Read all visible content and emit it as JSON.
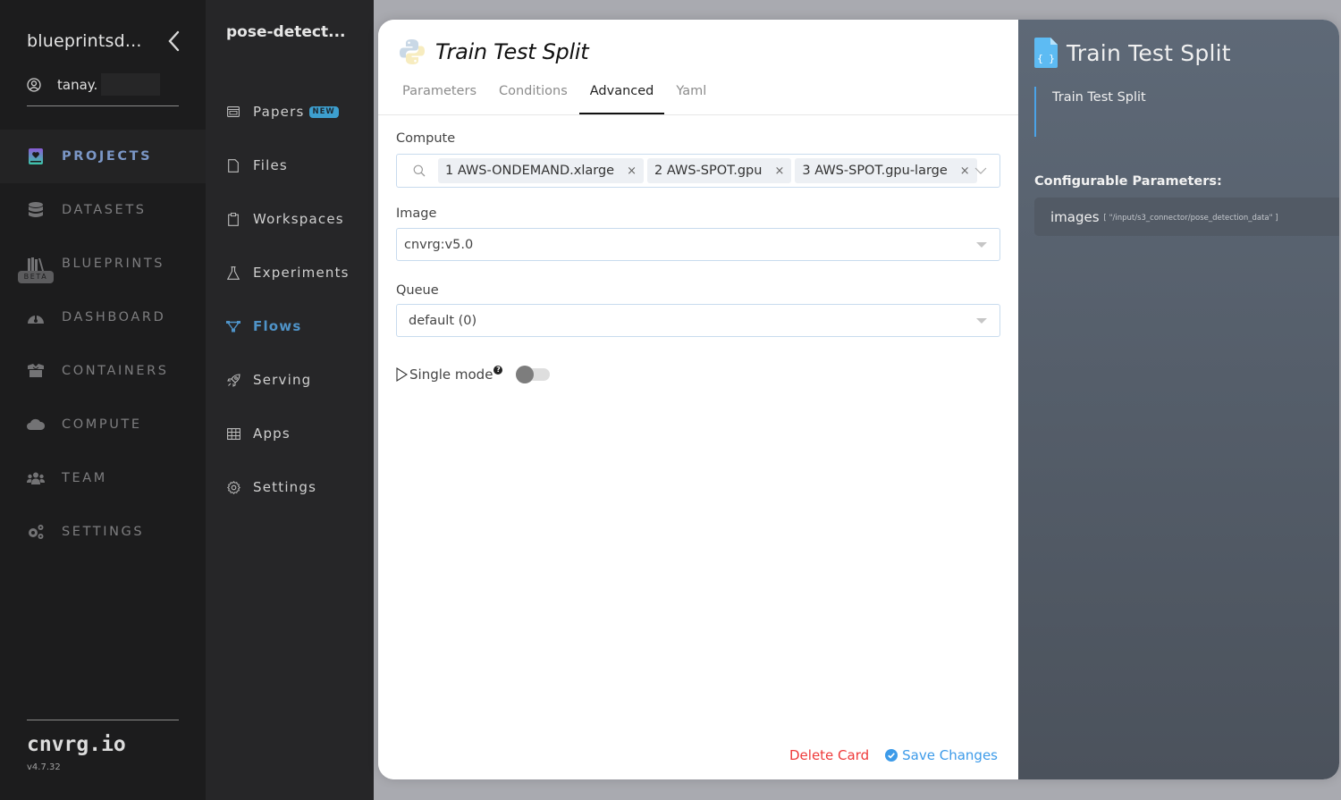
{
  "sidebar": {
    "org_name": "blueprintsd...",
    "user_name": "tanay.",
    "nav": [
      {
        "label": "PROJECTS",
        "icon": "projects-book-icon",
        "active": true
      },
      {
        "label": "DATASETS",
        "icon": "database-icon",
        "active": false
      },
      {
        "label": "BLUEPRINTS",
        "icon": "books-icon",
        "active": false,
        "badge": "BETA"
      },
      {
        "label": "DASHBOARD",
        "icon": "gauge-icon",
        "active": false
      },
      {
        "label": "CONTAINERS",
        "icon": "box-icon",
        "active": false
      },
      {
        "label": "COMPUTE",
        "icon": "cloud-icon",
        "active": false
      },
      {
        "label": "TEAM",
        "icon": "users-icon",
        "active": false
      },
      {
        "label": "SETTINGS",
        "icon": "gears-icon",
        "active": false
      }
    ],
    "brand": "cnvrg.io",
    "version": "v4.7.32"
  },
  "project_sidebar": {
    "title": "pose-detect...",
    "items": [
      {
        "label": "Papers",
        "icon": "papers-icon",
        "badge": "NEW"
      },
      {
        "label": "Files",
        "icon": "file-icon"
      },
      {
        "label": "Workspaces",
        "icon": "clipboard-icon"
      },
      {
        "label": "Experiments",
        "icon": "flask-icon"
      },
      {
        "label": "Flows",
        "icon": "flows-icon",
        "active": true
      },
      {
        "label": "Serving",
        "icon": "rocket-icon"
      },
      {
        "label": "Apps",
        "icon": "grid-icon"
      },
      {
        "label": "Settings",
        "icon": "gear-icon"
      }
    ]
  },
  "card": {
    "title": "Train Test Split",
    "tabs": [
      {
        "label": "Parameters",
        "active": false
      },
      {
        "label": "Conditions",
        "active": false
      },
      {
        "label": "Advanced",
        "active": true
      },
      {
        "label": "Yaml",
        "active": false
      }
    ],
    "compute": {
      "label": "Compute",
      "tags": [
        "1 AWS-ONDEMAND.xlarge",
        "2 AWS-SPOT.gpu",
        "3 AWS-SPOT.gpu-large"
      ],
      "remove_glyph": "×"
    },
    "image": {
      "label": "Image",
      "value": "cnvrg:v5.0"
    },
    "queue": {
      "label": "Queue",
      "value": "default (0)"
    },
    "single_mode": {
      "label": "Single mode",
      "help": "?",
      "enabled": false
    },
    "delete_label": "Delete Card",
    "save_label": "Save Changes"
  },
  "details": {
    "title": "Train Test Split",
    "description": "Train Test Split",
    "configurable_label": "Configurable Parameters:",
    "params": [
      {
        "name": "images",
        "value": "[ \"/input/s3_connector/pose_detection_data\" ]"
      }
    ]
  },
  "colors": {
    "accent_blue": "#3d9be9",
    "active_nav": "#7b97c7",
    "flows_active": "#4f93c8",
    "delete_red": "#ef3a3a",
    "new_badge": "#3d9fcf"
  }
}
